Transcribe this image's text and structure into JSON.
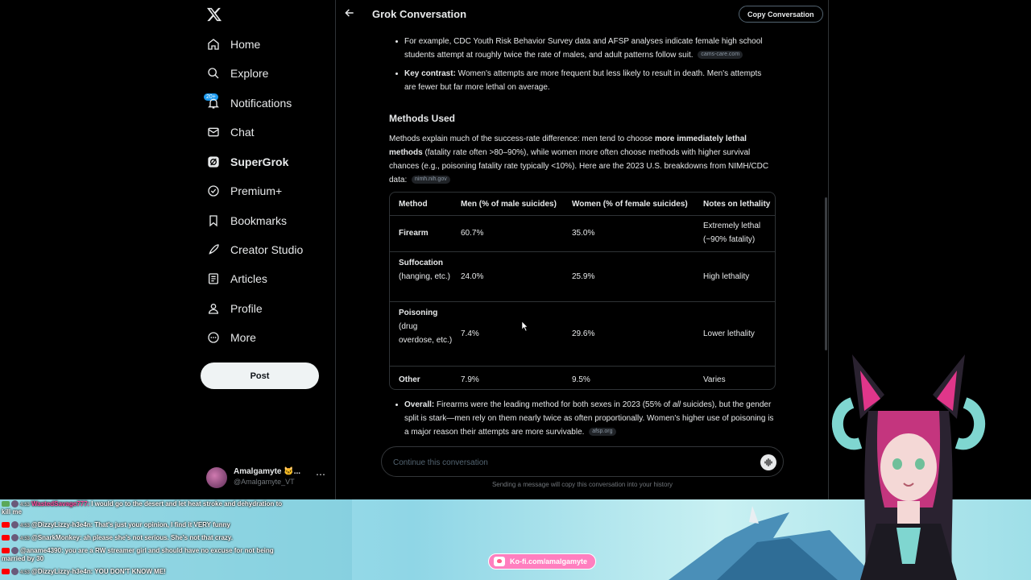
{
  "sidebar": {
    "logo": "x-logo",
    "notif_badge": "20+",
    "items": [
      {
        "label": "Home",
        "icon": "home-icon"
      },
      {
        "label": "Explore",
        "icon": "search-icon"
      },
      {
        "label": "Notifications",
        "icon": "bell-icon"
      },
      {
        "label": "Chat",
        "icon": "mail-icon"
      },
      {
        "label": "SuperGrok",
        "icon": "grok-icon"
      },
      {
        "label": "Premium+",
        "icon": "verified-icon"
      },
      {
        "label": "Bookmarks",
        "icon": "bookmark-icon"
      },
      {
        "label": "Creator Studio",
        "icon": "rocket-icon"
      },
      {
        "label": "Articles",
        "icon": "article-icon"
      },
      {
        "label": "Profile",
        "icon": "person-icon"
      },
      {
        "label": "More",
        "icon": "more-circle-icon"
      }
    ],
    "post_label": "Post",
    "account": {
      "name": "Amalgamyte 🐱...",
      "handle": "@Amalgamyte_VT"
    }
  },
  "main": {
    "title": "Grok Conversation",
    "copy_label": "Copy Conversation",
    "bullet1_text": "For example, CDC Youth Risk Behavior Survey data and AFSP analyses indicate female high school students attempt at roughly twice the rate of males, and adult patterns follow suit.",
    "bullet1_src": "cams-care.com",
    "bullet2_bold": "Key contrast:",
    "bullet2_text": " Women's attempts are more frequent but less likely to result in death. Men's attempts are fewer but far more lethal on average.",
    "heading": "Methods Used",
    "para_a": "Methods explain much of the success-rate difference: men tend to choose ",
    "para_bold": "more immediately lethal methods",
    "para_b": " (fatality rate often >80–90%), while women more often choose methods with higher survival chances (e.g., poisoning fatality rate typically <10%). Here are the 2023 U.S. breakdowns from NIMH/CDC data:",
    "para_src": "nimh.nih.gov",
    "table": {
      "headers": [
        "Method",
        "Men (% of male suicides)",
        "Women (% of female suicides)",
        "Notes on lethality"
      ],
      "rows": [
        {
          "method": "Firearm",
          "method_sub": "",
          "men": "60.7%",
          "women": "35.0%",
          "notes": "Extremely lethal (~90% fatality)"
        },
        {
          "method": "Suffocation",
          "method_sub": "(hanging, etc.)",
          "men": "24.0%",
          "women": "25.9%",
          "notes": "High lethality"
        },
        {
          "method": "Poisoning",
          "method_sub": "(drug overdose, etc.)",
          "men": "7.4%",
          "women": "29.6%",
          "notes": "Lower lethality"
        },
        {
          "method": "Other",
          "method_sub": "",
          "men": "7.9%",
          "women": "9.5%",
          "notes": "Varies"
        }
      ]
    },
    "overall_bold": "Overall:",
    "overall_a": " Firearms were the leading method for both sexes in 2023 (55% of ",
    "overall_italic": "all",
    "overall_b": " suicides), but the gender split is stark—men rely on them nearly twice as often proportionally. Women's higher use of poisoning is a major reason their attempts are more survivable.",
    "overall_src": "afsp.org",
    "input_placeholder": "Continue this conversation",
    "hint": "Sending a message will copy this conversation into your history"
  },
  "stream": {
    "chat": [
      {
        "user": "WastedSavage777:",
        "msg": "I would go to the desert and let heat stroke and dehydration to",
        "cont": "kill me"
      },
      {
        "user": "@DizzyLizzy-h3e4n:",
        "msg": "That's just your opinion, I find it VERY funny"
      },
      {
        "user": "@SnarkMonkey:",
        "msg": "ah please she's not serious. She's not that crazy."
      },
      {
        "user": "@aname4390:",
        "msg": "you are a RW streamer girl and should have no excuse for not being",
        "cont": "married by 30"
      },
      {
        "user": "@DizzyLizzy-h3e4n:",
        "msg": "YOU DON'T KNOW ME!"
      }
    ],
    "kofi": "Ko-fi.com/amalgamyte"
  },
  "colors": {
    "accent": "#1d9bf0",
    "background": "#000000",
    "text": "#e7e9ea",
    "border": "#2f3336",
    "kofi": "#ff7fbf"
  }
}
